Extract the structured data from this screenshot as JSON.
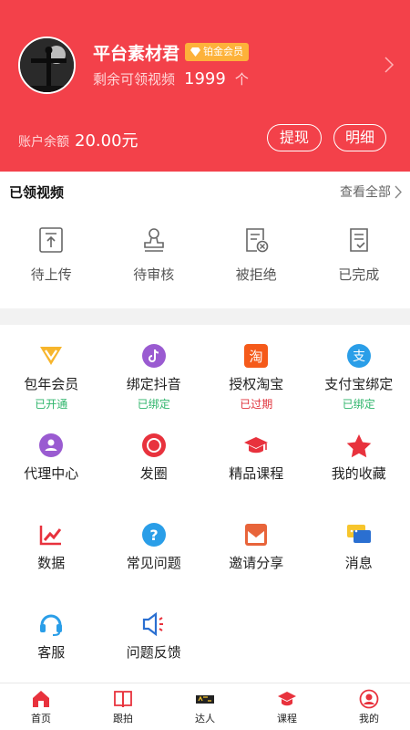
{
  "profile": {
    "username": "平台素材君",
    "vip_badge": "铂金会员",
    "remaining_label": "剩余可领视频",
    "remaining_count": "1999",
    "remaining_unit": "个",
    "balance_label": "账户余额",
    "balance_amount": "20.00元",
    "withdraw_label": "提现",
    "detail_label": "明细"
  },
  "claimed": {
    "title": "已领视频",
    "view_all": "查看全部",
    "statuses": [
      {
        "label": "待上传",
        "icon": "upload-icon"
      },
      {
        "label": "待审核",
        "icon": "stamp-icon"
      },
      {
        "label": "被拒绝",
        "icon": "rejected-doc-icon"
      },
      {
        "label": "已完成",
        "icon": "completed-doc-icon"
      }
    ]
  },
  "services": [
    {
      "label": "包年会员",
      "sub": "已开通",
      "sub_color": "#2fb56b",
      "icon": "vip-crown-icon",
      "color": "#f7b52c"
    },
    {
      "label": "绑定抖音",
      "sub": "已绑定",
      "sub_color": "#2fb56b",
      "icon": "tiktok-icon",
      "color": "#9a5bd1"
    },
    {
      "label": "授权淘宝",
      "sub": "已过期",
      "sub_color": "#e0333c",
      "icon": "taobao-icon",
      "color": "#f55a1a"
    },
    {
      "label": "支付宝绑定",
      "sub": "已绑定",
      "sub_color": "#2fb56b",
      "icon": "alipay-icon",
      "color": "#2a9ee8"
    },
    {
      "label": "代理中心",
      "icon": "agent-icon",
      "color": "#9a5bd1"
    },
    {
      "label": "发圈",
      "icon": "moments-icon",
      "color": "#e8323d"
    },
    {
      "label": "精品课程",
      "icon": "graduation-cap-icon",
      "color": "#e8323d"
    },
    {
      "label": "我的收藏",
      "icon": "star-icon",
      "color": "#e8323d"
    },
    {
      "label": "数据",
      "icon": "chart-icon",
      "color": "#e8323d"
    },
    {
      "label": "常见问题",
      "icon": "question-icon",
      "color": "#2a9ee8"
    },
    {
      "label": "邀请分享",
      "icon": "invite-icon",
      "color": "#e8643a"
    },
    {
      "label": "消息",
      "icon": "message-icon",
      "color": "#f7c52c"
    },
    {
      "label": "客服",
      "icon": "headset-icon",
      "color": "#2a9ee8"
    },
    {
      "label": "问题反馈",
      "icon": "megaphone-icon",
      "color": "#2a6fd1"
    }
  ],
  "nav": [
    {
      "label": "首页",
      "icon": "home-icon"
    },
    {
      "label": "跟拍",
      "icon": "book-icon"
    },
    {
      "label": "达人",
      "icon": "star-logo-icon"
    },
    {
      "label": "课程",
      "icon": "cap-icon"
    },
    {
      "label": "我的",
      "icon": "user-icon"
    }
  ],
  "colors": {
    "brand": "#f3414a",
    "vip": "#fdb23a"
  }
}
